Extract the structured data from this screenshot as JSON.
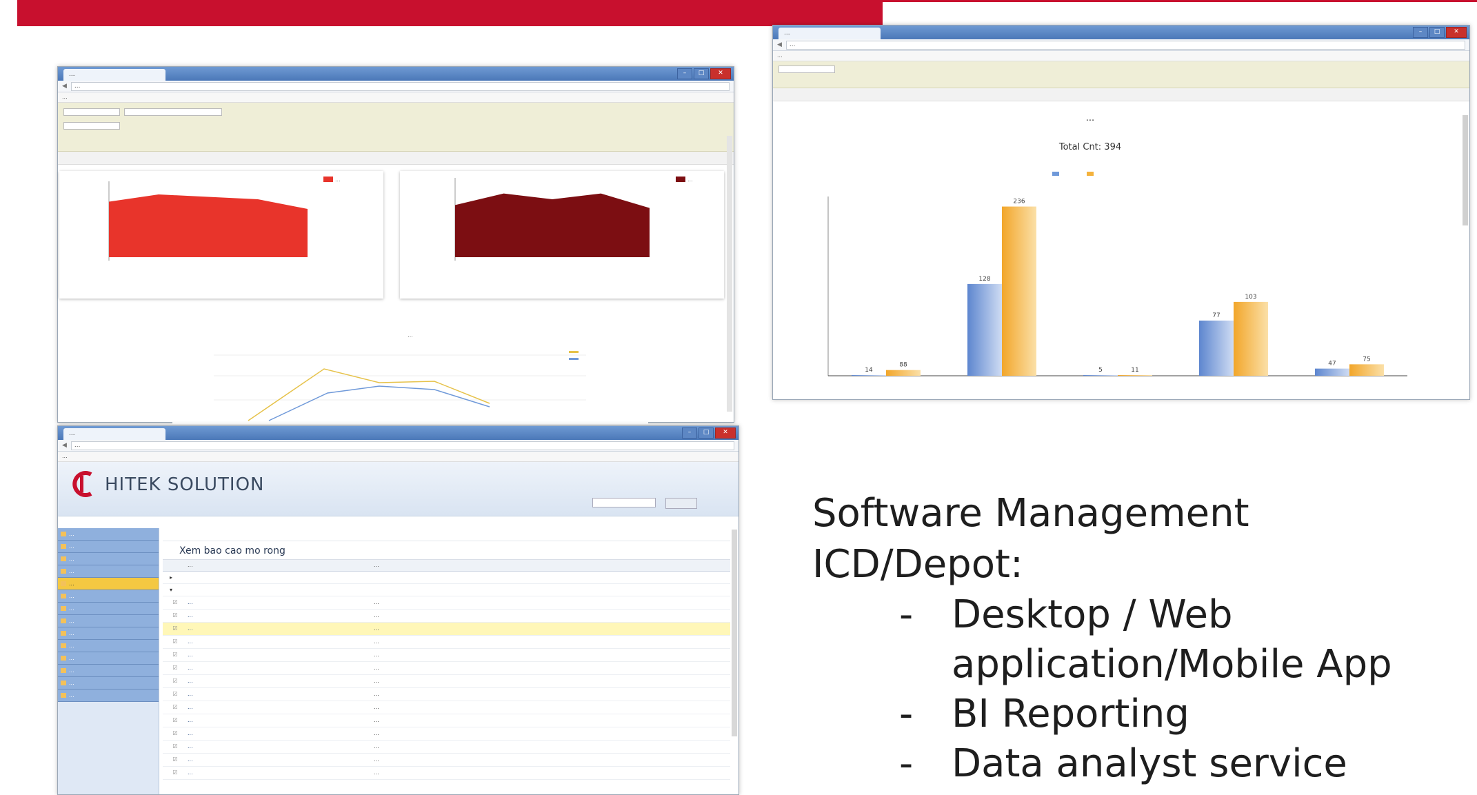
{
  "colors": {
    "brand_red": "#c8102e",
    "area_red": "#e8342b",
    "area_dark": "#7c0e12",
    "bar_blue": "#6f99d9",
    "bar_orange": "#f4b23c"
  },
  "win1": {
    "tab": "...",
    "url": "...",
    "bookmarks": "...",
    "chart_left": {
      "legend": "...",
      "values": [
        23,
        26,
        25,
        24,
        20
      ]
    },
    "chart_right": {
      "legend": "...",
      "values": [
        18,
        22,
        20,
        22,
        17
      ]
    },
    "line_chart": {
      "title": "..."
    }
  },
  "win2": {
    "tab": "...",
    "url": "...",
    "bookmarks": "...",
    "chart_data": {
      "type": "bar",
      "title": "...",
      "subtitle": "Total Cnt: 394",
      "categories": [
        "...",
        "...",
        "...",
        "...",
        "..."
      ],
      "series": [
        {
          "values": [
            1,
            128,
            1,
            77,
            10
          ]
        },
        {
          "values": [
            8,
            236,
            1,
            103,
            16
          ]
        }
      ],
      "data_labels": [
        [
          "14",
          "128",
          "5",
          "77",
          "47"
        ],
        [
          "88",
          "236",
          "11",
          "103",
          "75"
        ]
      ],
      "ylim": [
        0,
        250
      ],
      "grid": false,
      "legend_position": "top"
    }
  },
  "win3": {
    "tab": "...",
    "url": "...",
    "bookmarks": "...",
    "logo_text": "HITEK SOLUTION",
    "section_title": "Xem bao cao mo rong",
    "sidebar": [
      "...",
      "...",
      "...",
      "...",
      "...",
      "...",
      "...",
      "...",
      "...",
      "...",
      "...",
      "...",
      "...",
      "..."
    ],
    "grid_cols": [
      "...",
      "..."
    ],
    "rows": [
      {
        "name": "...",
        "desc": "..."
      },
      {
        "name": "...",
        "desc": "..."
      },
      {
        "name": "...",
        "desc": "..."
      },
      {
        "name": "...",
        "desc": "..."
      },
      {
        "name": "...",
        "desc": "..."
      },
      {
        "name": "...",
        "desc": "..."
      },
      {
        "name": "...",
        "desc": "..."
      },
      {
        "name": "...",
        "desc": "..."
      },
      {
        "name": "...",
        "desc": "..."
      },
      {
        "name": "...",
        "desc": "..."
      },
      {
        "name": "...",
        "desc": "..."
      },
      {
        "name": "...",
        "desc": "..."
      },
      {
        "name": "...",
        "desc": "..."
      },
      {
        "name": "...",
        "desc": "..."
      }
    ]
  },
  "slide": {
    "heading_line1": "Software Management",
    "heading_line2": "ICD/Depot:",
    "bullets": [
      {
        "line1": "Desktop / Web",
        "line2": "application/Mobile App"
      },
      {
        "line1": "BI Reporting"
      },
      {
        "line1": "Data analyst service"
      }
    ]
  }
}
